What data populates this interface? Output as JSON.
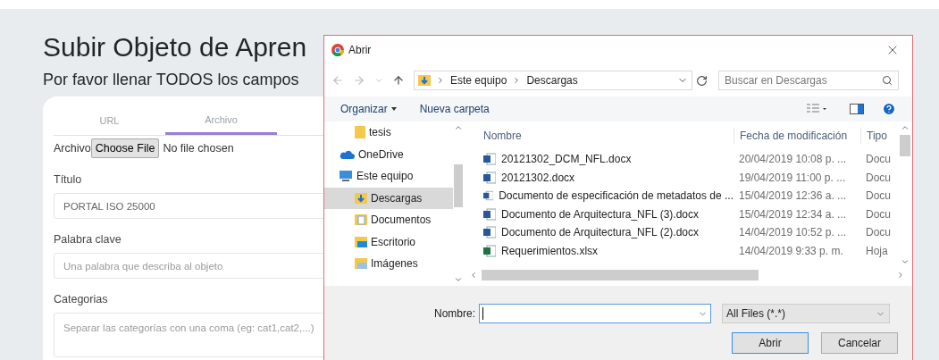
{
  "page": {
    "title": "Subir Objeto de Apren",
    "subtitle": "Por favor llenar TODOS los campos",
    "tabs": [
      {
        "label": "URL",
        "selected": false
      },
      {
        "label": "Archivo",
        "selected": true
      }
    ],
    "file_input": {
      "label": "Archivo",
      "button": "Choose File",
      "status": "No file chosen"
    },
    "fields": [
      {
        "label": "Título",
        "value": "PORTAL ISO 25000",
        "kind": "input"
      },
      {
        "label": "Palabra clave",
        "placeholder": "Una palabra que describa al objeto",
        "kind": "input"
      },
      {
        "label": "Categorias",
        "placeholder": "Separar las categorías con una coma (eg: cat1,cat2,...)",
        "kind": "textarea"
      }
    ]
  },
  "dialog": {
    "title": "Abrir",
    "path": [
      "Este equipo",
      "Descargas"
    ],
    "search": {
      "placeholder": "Buscar en Descargas"
    },
    "toolbar": {
      "organize": "Organizar",
      "new_folder": "Nueva carpeta"
    },
    "nav": [
      {
        "label": "tesis",
        "kind": "folder",
        "selected": false
      },
      {
        "label": "OneDrive",
        "kind": "cloud",
        "selected": false
      },
      {
        "label": "Este equipo",
        "kind": "computer",
        "selected": false,
        "children": [
          {
            "label": "Descargas",
            "kind": "downloads",
            "selected": true
          },
          {
            "label": "Documentos",
            "kind": "documents",
            "selected": false
          },
          {
            "label": "Escritorio",
            "kind": "desktop",
            "selected": false
          },
          {
            "label": "Imágenes",
            "kind": "pictures",
            "selected": false
          }
        ]
      }
    ],
    "columns": [
      "Nombre",
      "Fecha de modificación",
      "Tipo"
    ],
    "files": [
      {
        "name": "20121302_DCM_NFL.docx",
        "date": "20/04/2019 10:08 p. ...",
        "type": "Docu",
        "kind": "word"
      },
      {
        "name": "20121302.docx",
        "date": "19/04/2019 11:00 p. ...",
        "type": "Docu",
        "kind": "word"
      },
      {
        "name": "Documento de especificación de metadatos de ...",
        "date": "15/04/2019 12:36 a. ...",
        "type": "Docu",
        "kind": "word"
      },
      {
        "name": "Documento de Arquitectura_NFL (3).docx",
        "date": "15/04/2019 12:34 a. ...",
        "type": "Docu",
        "kind": "word"
      },
      {
        "name": "Documento de Arquitectura_NFL (2).docx",
        "date": "14/04/2019 10:52 p. ...",
        "type": "Docu",
        "kind": "word"
      },
      {
        "name": "Requerimientos.xlsx",
        "date": "14/04/2019 9:33 p. m.",
        "type": "Hoja",
        "kind": "excel"
      }
    ],
    "filename_label": "Nombre:",
    "filter": "All Files (*.*)",
    "buttons": {
      "open": "Abrir",
      "cancel": "Cancelar"
    }
  }
}
